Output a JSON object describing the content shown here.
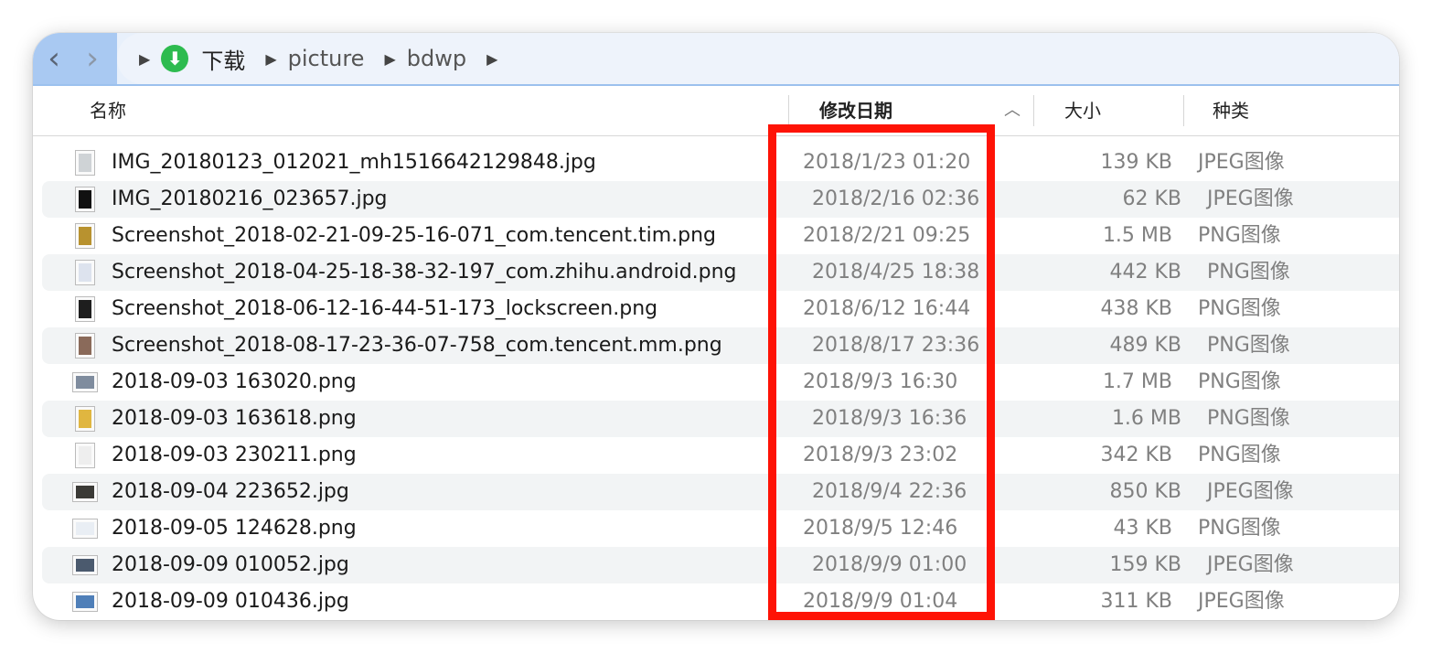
{
  "toolbar": {
    "back_icon": "chevron-left-icon",
    "forward_icon": "chevron-right-icon",
    "breadcrumb": [
      {
        "label": "下载",
        "icon": "download-icon"
      },
      {
        "label": "picture"
      },
      {
        "label": "bdwp"
      }
    ]
  },
  "columns": {
    "name": "名称",
    "date": "修改日期",
    "size": "大小",
    "kind": "种类",
    "sort_icon": "chevron-up-icon"
  },
  "files": [
    {
      "name": "IMG_20180123_012021_mh1516642129848.jpg",
      "date": "2018/1/23 01:20",
      "size": "139 KB",
      "kind": "JPEG图像",
      "thumb": "#cfd3d6"
    },
    {
      "name": "IMG_20180216_023657.jpg",
      "date": "2018/2/16 02:36",
      "size": "62 KB",
      "kind": "JPEG图像",
      "thumb": "#111111"
    },
    {
      "name": "Screenshot_2018-02-21-09-25-16-071_com.tencent.tim.png",
      "date": "2018/2/21 09:25",
      "size": "1.5 MB",
      "kind": "PNG图像",
      "thumb": "#b8922f"
    },
    {
      "name": "Screenshot_2018-04-25-18-38-32-197_com.zhihu.android.png",
      "date": "2018/4/25 18:38",
      "size": "442 KB",
      "kind": "PNG图像",
      "thumb": "#dde3ee"
    },
    {
      "name": "Screenshot_2018-06-12-16-44-51-173_lockscreen.png",
      "date": "2018/6/12 16:44",
      "size": "438 KB",
      "kind": "PNG图像",
      "thumb": "#1e1e1e"
    },
    {
      "name": "Screenshot_2018-08-17-23-36-07-758_com.tencent.mm.png",
      "date": "2018/8/17 23:36",
      "size": "489 KB",
      "kind": "PNG图像",
      "thumb": "#8a6a5a"
    },
    {
      "name": "2018-09-03 163020.png",
      "date": "2018/9/3 16:30",
      "size": "1.7 MB",
      "kind": "PNG图像",
      "thumb": "#7f8c9e",
      "landscape": true
    },
    {
      "name": "2018-09-03 163618.png",
      "date": "2018/9/3 16:36",
      "size": "1.6 MB",
      "kind": "PNG图像",
      "thumb": "#e0b640"
    },
    {
      "name": "2018-09-03 230211.png",
      "date": "2018/9/3 23:02",
      "size": "342 KB",
      "kind": "PNG图像",
      "thumb": "#eeeeee"
    },
    {
      "name": "2018-09-04 223652.jpg",
      "date": "2018/9/4 22:36",
      "size": "850 KB",
      "kind": "JPEG图像",
      "thumb": "#3b3a36",
      "landscape": true
    },
    {
      "name": "2018-09-05 124628.png",
      "date": "2018/9/5 12:46",
      "size": "43 KB",
      "kind": "PNG图像",
      "thumb": "#e9eef4",
      "landscape": true
    },
    {
      "name": "2018-09-09 010052.jpg",
      "date": "2018/9/9 01:00",
      "size": "159 KB",
      "kind": "JPEG图像",
      "thumb": "#4b5a6e",
      "landscape": true
    },
    {
      "name": "2018-09-09 010436.jpg",
      "date": "2018/9/9 01:04",
      "size": "311 KB",
      "kind": "JPEG图像",
      "thumb": "#4f7fb8",
      "landscape": true
    }
  ],
  "highlight_color": "#fe1306",
  "accent_color": "#a9c9f2"
}
